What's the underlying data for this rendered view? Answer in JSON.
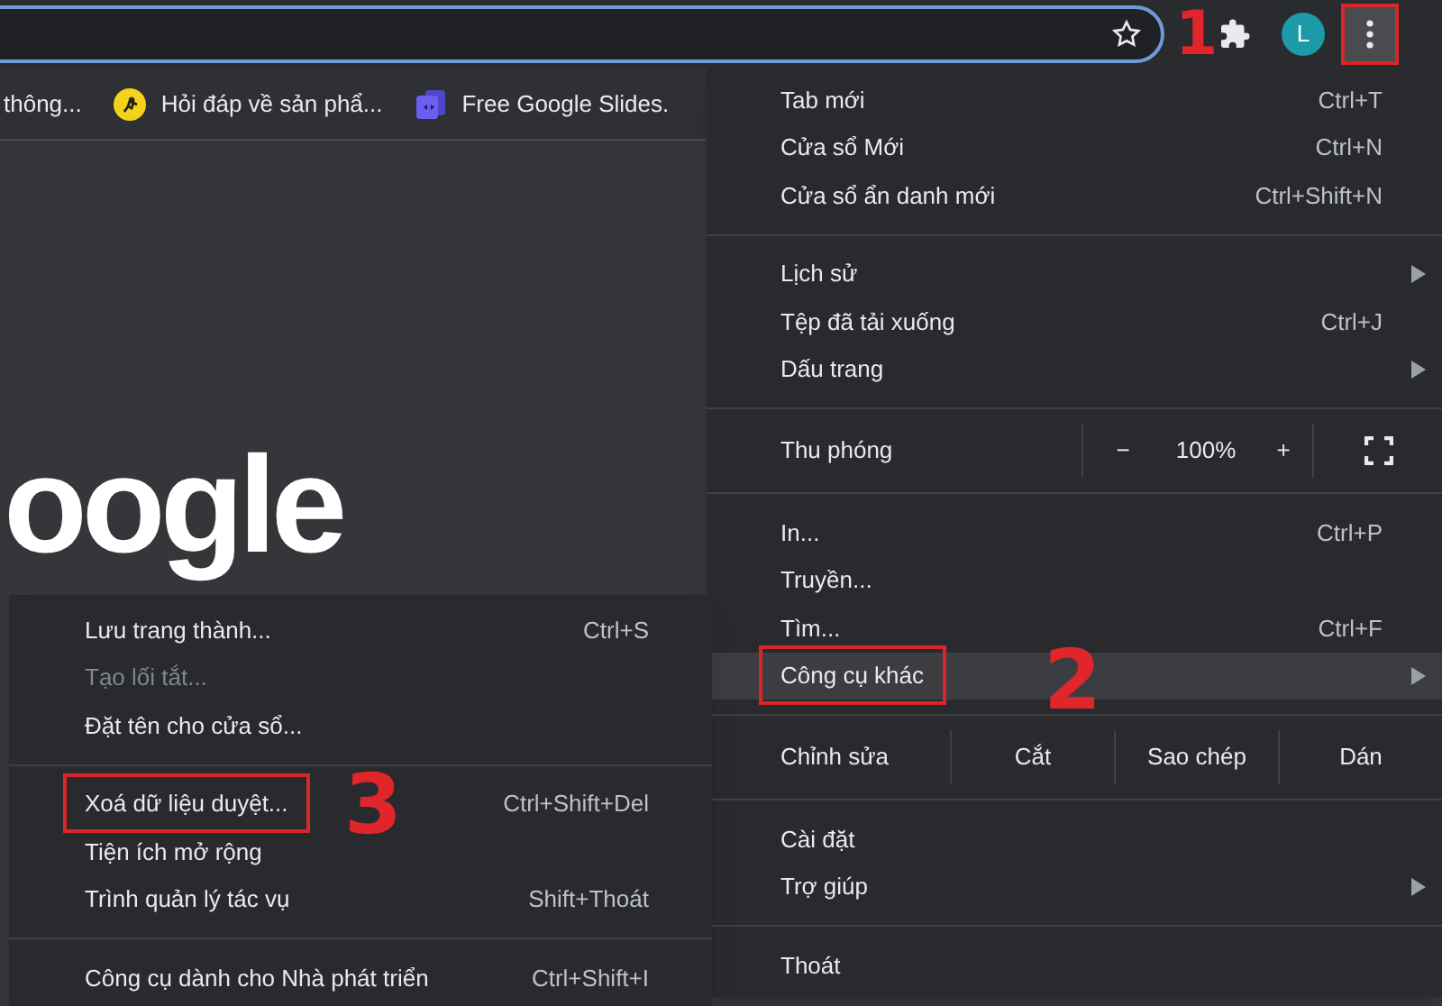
{
  "toolbar": {
    "avatar": "L",
    "menu_marked": true,
    "menu_marker": "1"
  },
  "bookmarks": [
    {
      "label": "thông...",
      "kind": "plain"
    },
    {
      "label": "Hỏi đáp về sản phẩ...",
      "kind": "runner"
    },
    {
      "label": "Free Google Slides.",
      "kind": "slides"
    }
  ],
  "page": {
    "logo": "oogle"
  },
  "menu": [
    {
      "kind": "item",
      "label": "Tab mới",
      "shortcut": "Ctrl+T"
    },
    {
      "kind": "item",
      "label": "Cửa sổ Mới",
      "shortcut": "Ctrl+N"
    },
    {
      "kind": "item",
      "label": "Cửa sổ ẩn danh mới",
      "shortcut": "Ctrl+Shift+N"
    },
    {
      "kind": "separator"
    },
    {
      "kind": "item",
      "label": "Lịch sử",
      "submenu": true
    },
    {
      "kind": "item",
      "label": "Tệp đã tải xuống",
      "shortcut": "Ctrl+J"
    },
    {
      "kind": "item",
      "label": "Dấu trang",
      "submenu": true
    },
    {
      "kind": "separator"
    },
    {
      "kind": "zoom",
      "label": "Thu phóng",
      "minus": "−",
      "value": "100%",
      "plus": "+"
    },
    {
      "kind": "separator"
    },
    {
      "kind": "item",
      "label": "In...",
      "shortcut": "Ctrl+P"
    },
    {
      "kind": "item",
      "label": "Truyền..."
    },
    {
      "kind": "item",
      "label": "Tìm...",
      "shortcut": "Ctrl+F"
    },
    {
      "kind": "item",
      "label": "Công cụ khác",
      "submenu": true,
      "selected": true,
      "marked": true,
      "marker": "2"
    },
    {
      "kind": "separator"
    },
    {
      "kind": "edit",
      "label": "Chỉnh sửa",
      "actions": [
        "Cắt",
        "Sao chép",
        "Dán"
      ]
    },
    {
      "kind": "separator"
    },
    {
      "kind": "item",
      "label": "Cài đặt"
    },
    {
      "kind": "item",
      "label": "Trợ giúp",
      "submenu": true
    },
    {
      "kind": "separator"
    },
    {
      "kind": "item",
      "label": "Thoát"
    }
  ],
  "submenu": [
    {
      "kind": "item",
      "label": "Lưu trang thành...",
      "shortcut": "Ctrl+S"
    },
    {
      "kind": "item",
      "label": "Tạo lối tắt...",
      "disabled": true
    },
    {
      "kind": "item",
      "label": "Đặt tên cho cửa sổ..."
    },
    {
      "kind": "separator"
    },
    {
      "kind": "item",
      "label": "Xoá dữ liệu duyệt...",
      "shortcut": "Ctrl+Shift+Del",
      "marked": true,
      "marker": "3"
    },
    {
      "kind": "item",
      "label": "Tiện ích mở rộng"
    },
    {
      "kind": "item",
      "label": "Trình quản lý tác vụ",
      "shortcut": "Shift+Thoát"
    },
    {
      "kind": "separator"
    },
    {
      "kind": "item",
      "label": "Công cụ dành cho Nhà phát triển",
      "shortcut": "Ctrl+Shift+I"
    }
  ]
}
